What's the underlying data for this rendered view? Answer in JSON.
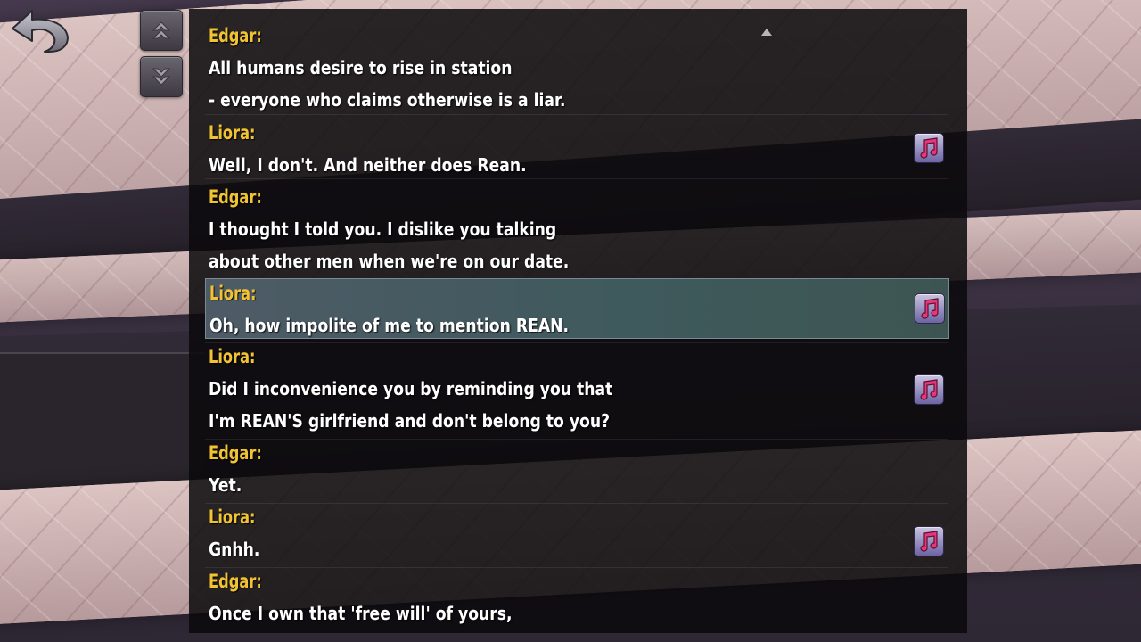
{
  "log": {
    "entries": [
      {
        "speaker": "Edgar:",
        "lines": [
          "All humans desire to rise in station",
          "- everyone who claims otherwise is a liar."
        ],
        "voice": false
      },
      {
        "speaker": "Liora:",
        "lines": [
          "Well, I don't. And neither does Rean."
        ],
        "voice": true
      },
      {
        "speaker": "Edgar:",
        "lines": [
          "I thought I told you. I dislike you talking",
          "about other men when we're on our date."
        ],
        "voice": false
      },
      {
        "speaker": "Liora:",
        "lines": [
          "Oh, how impolite of me to mention REAN."
        ],
        "voice": true,
        "selected": true
      },
      {
        "speaker": "Liora:",
        "lines": [
          "Did I inconvenience you by reminding you that",
          "I'm REAN'S girlfriend and don't belong to you?"
        ],
        "voice": true
      },
      {
        "speaker": "Edgar:",
        "lines": [
          "Yet."
        ],
        "voice": false
      },
      {
        "speaker": "Liora:",
        "lines": [
          "Gnhh."
        ],
        "voice": true
      },
      {
        "speaker": "Edgar:",
        "lines": [
          "Once I own that 'free will' of yours,"
        ],
        "voice": false
      }
    ]
  },
  "icons": {
    "back": "back-arrow-icon",
    "scroll_up": "double-chevron-up-icon",
    "scroll_down": "double-chevron-down-icon",
    "voice": "music-note-icon",
    "more_above": "triangle-up-icon",
    "more_below": "triangle-down-icon"
  },
  "colors": {
    "speaker": "#f1c232",
    "text": "#ffffff",
    "selected_row": "#3f5a5d",
    "voice_note": "#e8367c"
  }
}
